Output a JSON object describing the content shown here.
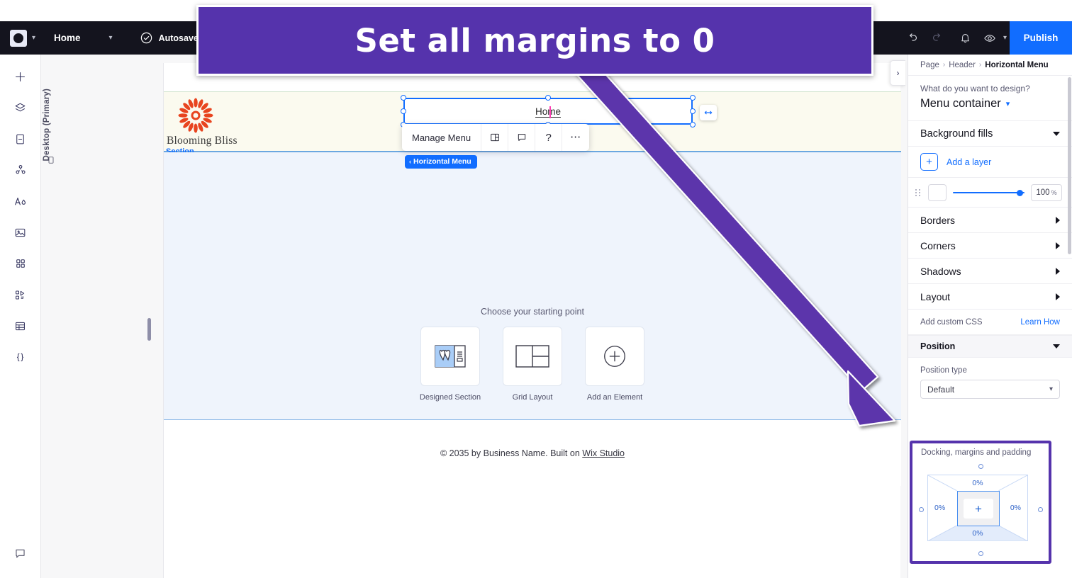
{
  "callout": {
    "text": "Set all margins to 0",
    "bg": "#5533ac",
    "fg": "#ffffff"
  },
  "topbar": {
    "logo_icon": "wix-studio-logo-icon",
    "logo_chevron": "chevron-down-icon",
    "page_name": "Home",
    "page_chevron": "chevron-down-icon",
    "autosave_icon": "cloud-check-icon",
    "autosave_label": "Autosave on",
    "undo_icon": "undo-icon",
    "redo_icon": "redo-icon",
    "notifications_icon": "bell-icon",
    "preview_icon": "eye-icon",
    "preview_chevron": "chevron-down-icon",
    "publish_label": "Publish",
    "publish_color": "#116dff",
    "bg": "#14141e"
  },
  "left_rail": {
    "items": [
      {
        "icon": "plus-add-icon",
        "name": "add-elements"
      },
      {
        "icon": "layers-icon",
        "name": "layers"
      },
      {
        "icon": "pages-icon",
        "name": "pages"
      },
      {
        "icon": "cms-icon",
        "name": "cms"
      },
      {
        "icon": "text-theme-icon",
        "name": "text-and-theme"
      },
      {
        "icon": "media-image-icon",
        "name": "media"
      },
      {
        "icon": "apps-grid-icon",
        "name": "apps"
      },
      {
        "icon": "interactions-icon",
        "name": "interactions"
      },
      {
        "icon": "dataset-table-icon",
        "name": "dataset"
      },
      {
        "icon": "code-braces-icon",
        "name": "dev-mode"
      }
    ],
    "bottom_icon": "chat-bubble-icon"
  },
  "stage": {
    "device_label": "Desktop (Primary)",
    "device_icon": "monitor-icon",
    "drag_handle": "canvas-resize-handle",
    "collapse_icon": "chevron-right-icon"
  },
  "site": {
    "brand_name": "Blooming Bliss",
    "logo_icon": "flower-burst-logo-icon",
    "section_tag": "Section",
    "menu_item": "Home",
    "resize_icon": "horizontal-resize-icon",
    "toolbar": {
      "manage_label": "Manage Menu",
      "layout_icon": "layout-panel-icon",
      "comment_icon": "comment-icon",
      "help_icon": "help-question-icon",
      "more_icon": "more-dots-icon"
    },
    "chip": {
      "back_icon": "chevron-left-icon",
      "label": "Horizontal Menu",
      "color": "#116dff"
    },
    "starting_title": "Choose your starting point",
    "starting_cards": [
      {
        "icon": "designed-section-icon",
        "label": "Designed Section"
      },
      {
        "icon": "grid-layout-icon",
        "label": "Grid Layout"
      },
      {
        "icon": "plus-circle-icon",
        "label": "Add an Element"
      }
    ],
    "footer_prefix": "© 2035 by Business Name. Built on ",
    "footer_link": "Wix Studio"
  },
  "panel": {
    "breadcrumb": {
      "items": [
        "Page",
        "Header"
      ],
      "current": "Horizontal Menu",
      "sep": "›"
    },
    "design_question": "What do you want to design?",
    "design_target": "Menu container",
    "design_chevron": "chevron-down-icon",
    "background_fills": {
      "label": "Background fills",
      "caret": "caret-down-icon"
    },
    "add_layer": {
      "plus": "+",
      "label": "Add a layer"
    },
    "opacity": {
      "grip": "drag-grip-icon",
      "swatch_color": "#ffffff",
      "value": "100",
      "unit": "%"
    },
    "rows": [
      {
        "label": "Borders",
        "caret": "caret-right-icon"
      },
      {
        "label": "Corners",
        "caret": "caret-right-icon"
      },
      {
        "label": "Shadows",
        "caret": "caret-right-icon"
      },
      {
        "label": "Layout",
        "caret": "caret-right-icon"
      }
    ],
    "custom_css": {
      "label": "Add custom CSS",
      "link": "Learn How"
    },
    "position_section": {
      "label": "Position",
      "caret": "caret-down-icon"
    },
    "position_type": {
      "label": "Position type",
      "value": "Default",
      "chevron": "chevron-down-icon"
    },
    "docking": {
      "label": "Docking, margins and padding",
      "top": "0%",
      "right": "0%",
      "bottom": "0%",
      "left": "0%",
      "center_icon": "plus-icon",
      "highlight_color": "#5533ac"
    }
  }
}
